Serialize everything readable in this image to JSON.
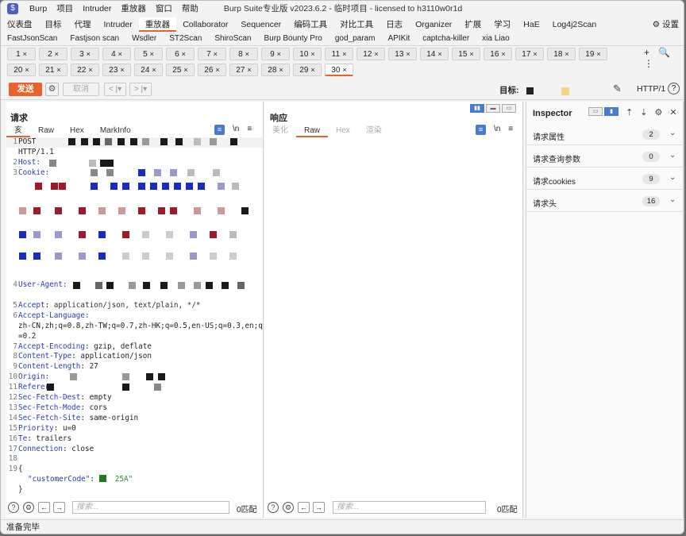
{
  "app": {
    "icon": "$",
    "window_title": "Burp Suite专业版  v2023.6.2 - 临时项目 - licensed to h3110w0r1d"
  },
  "menu": [
    "Burp",
    "项目",
    "Intruder",
    "重放器",
    "窗口",
    "帮助"
  ],
  "main_tabs": [
    "仪表盘",
    "目标",
    "代理",
    "Intruder",
    "重放器",
    "Collaborator",
    "Sequencer",
    "编码工具",
    "对比工具",
    "日志",
    "Organizer",
    "扩展",
    "学习",
    "HaE",
    "Log4j2Scan"
  ],
  "main_tab_active": "重放器",
  "settings_label": "设置",
  "extension_tabs": [
    "FastJsonScan",
    "Fastjson scan",
    "Wsdler",
    "ST2Scan",
    "ShiroScan",
    "Burp Bounty Pro",
    "god_param",
    "APIKit",
    "captcha-killer",
    "xia Liao"
  ],
  "repeater_tabs_row1": [
    "1",
    "2",
    "3",
    "4",
    "5",
    "6",
    "7",
    "8",
    "9",
    "10",
    "11",
    "12",
    "13",
    "14",
    "15",
    "16",
    "17",
    "18",
    "19"
  ],
  "repeater_tabs_row2": [
    "20",
    "21",
    "22",
    "23",
    "24",
    "25",
    "26",
    "27",
    "28",
    "29",
    "30"
  ],
  "repeater_tab_active": "30",
  "close_glyph": "×",
  "tab_tools": "+ 🔍 ⋮",
  "actions": {
    "send": "发送",
    "cancel": "取消",
    "back": "< |▾",
    "forward": "> |▾",
    "target_label": "目标:",
    "http_version": "HTTP/1",
    "help": "?"
  },
  "request": {
    "title": "请求",
    "subtabs": [
      "Pretty",
      "Raw",
      "Hex",
      "MarkInfo"
    ],
    "subtab_first_visible": "亥",
    "newline_toggle": "\\n",
    "menu_glyph": "≡",
    "lines": {
      "l1a": "POST",
      "l1b": "HTTP/1.1",
      "host_key": "Host",
      "cookie_key": "Cookie",
      "ua_key": "User-Agent",
      "accept_key": "Accept",
      "accept_val": " application/json, text/plain, */*",
      "lang_key": "Accept-Language",
      "lang_val1": "zh-CN,zh;q=0.8,zh-TW;q=0.7,zh-HK;q=0.5,en-US;q=0.3,en;q",
      "lang_val2": "=0.2",
      "enc_key": "Accept-Encoding",
      "enc_val": " gzip, deflate",
      "ctype_key": "Content-Type",
      "ctype_val": " application/json",
      "clen_key": "Content-Length",
      "clen_val": " 27",
      "origin_key": "Origin",
      "referer_key": "Referer",
      "sfd_key": "Sec-Fetch-Dest",
      "sfd_val": " empty",
      "sfm_key": "Sec-Fetch-Mode",
      "sfm_val": " cors",
      "sfs_key": "Sec-Fetch-Site",
      "sfs_val": " same-origin",
      "prio_key": "Priority",
      "prio_val": " u=0",
      "te_key": "Te",
      "te_val": " trailers",
      "conn_key": "Connection",
      "conn_val": " close",
      "brace_open": "{",
      "json_key": "\"customerCode\"",
      "json_val": "25A\"",
      "brace_close": "}"
    },
    "search_placeholder": "搜索...",
    "match_count": "0匹配"
  },
  "response": {
    "title": "响应",
    "subtabs": [
      "美化",
      "Raw",
      "Hex",
      "渲染"
    ],
    "subtab_active": "Raw",
    "newline_toggle": "\\n",
    "menu_glyph": "≡",
    "search_placeholder": "搜索...",
    "match_count": "0匹配"
  },
  "inspector": {
    "title": "Inspector",
    "sections": [
      {
        "label": "请求属性",
        "count": "2"
      },
      {
        "label": "请求查询参数",
        "count": "0"
      },
      {
        "label": "请求cookies",
        "count": "9"
      },
      {
        "label": "请求头",
        "count": "16"
      }
    ],
    "chevron": "⌄"
  },
  "status": "准备完毕",
  "colors": {
    "accent": "#e8632b",
    "header_key": "#2a3bb3",
    "json_value": "#2a8a2a",
    "redaction_blue": "#1a2bbf",
    "redaction_red": "#a11a2a",
    "redaction_black": "#1a1a1a"
  }
}
